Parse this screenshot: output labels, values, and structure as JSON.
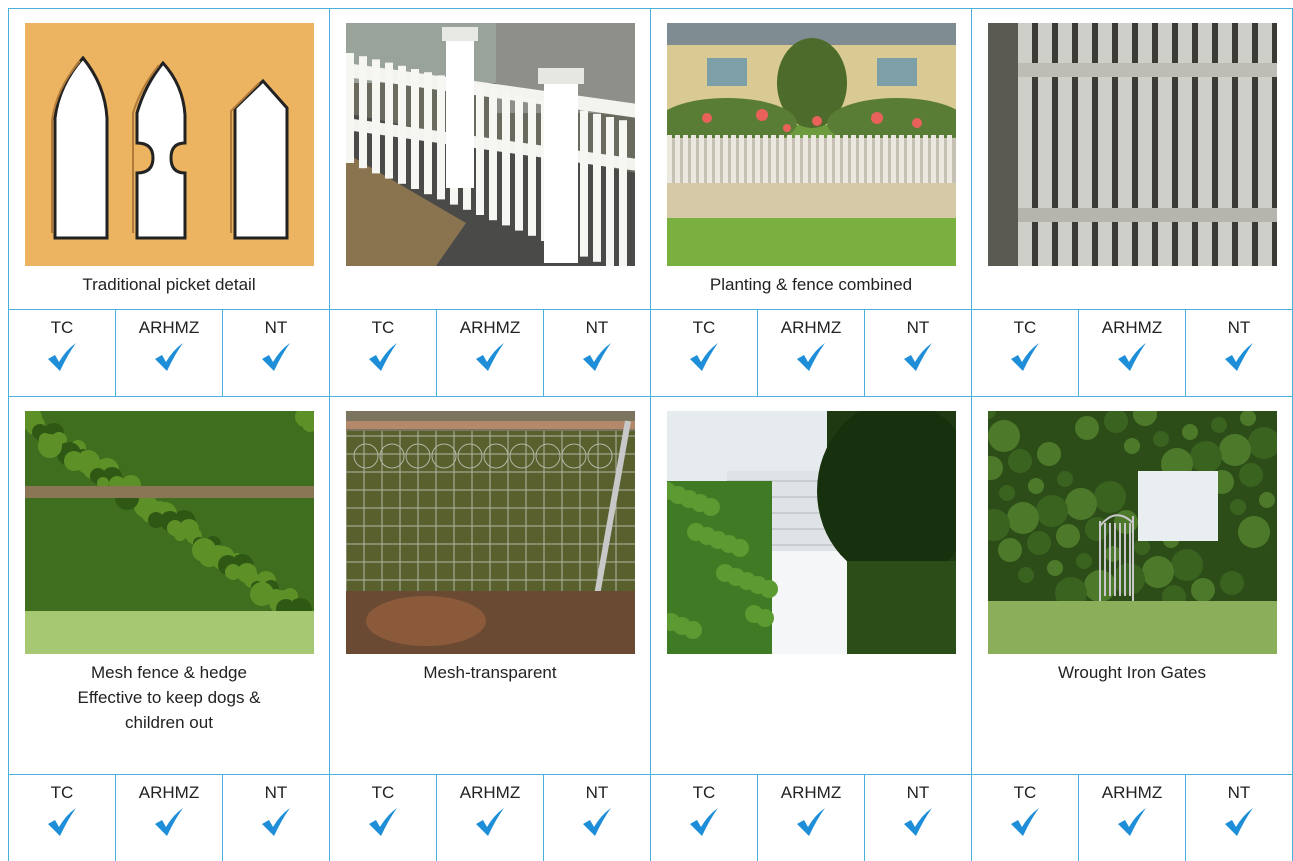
{
  "colors": {
    "grid_line": "#4cb0dc",
    "check": "#1e8ed8",
    "picket_bg": "#ecb461"
  },
  "check_labels": [
    "TC",
    "ARHMZ",
    "NT"
  ],
  "check_icon": "checkmark-icon",
  "rows": [
    {
      "cells": [
        {
          "photo": "picket-detail-illustration",
          "caption_lines": [
            "Traditional picket detail"
          ]
        },
        {
          "photo": "white-picket-fence-with-posts-photo",
          "caption_lines": []
        },
        {
          "photo": "cottage-garden-picket-fence-photo",
          "caption_lines": [
            "Planting & fence combined"
          ]
        },
        {
          "photo": "weathered-picket-fence-closeup-photo",
          "caption_lines": []
        }
      ]
    },
    {
      "cells": [
        {
          "photo": "mesh-fence-hedge-photo",
          "caption_lines": [
            "Mesh fence & hedge",
            "Effective to keep dogs &",
            "children out"
          ]
        },
        {
          "photo": "transparent-mesh-fence-photo",
          "caption_lines": [
            "Mesh-transparent"
          ]
        },
        {
          "photo": "white-gate-between-hedges-photo",
          "caption_lines": []
        },
        {
          "photo": "wrought-iron-gate-photo",
          "caption_lines": [
            "Wrought Iron Gates"
          ]
        }
      ]
    }
  ]
}
